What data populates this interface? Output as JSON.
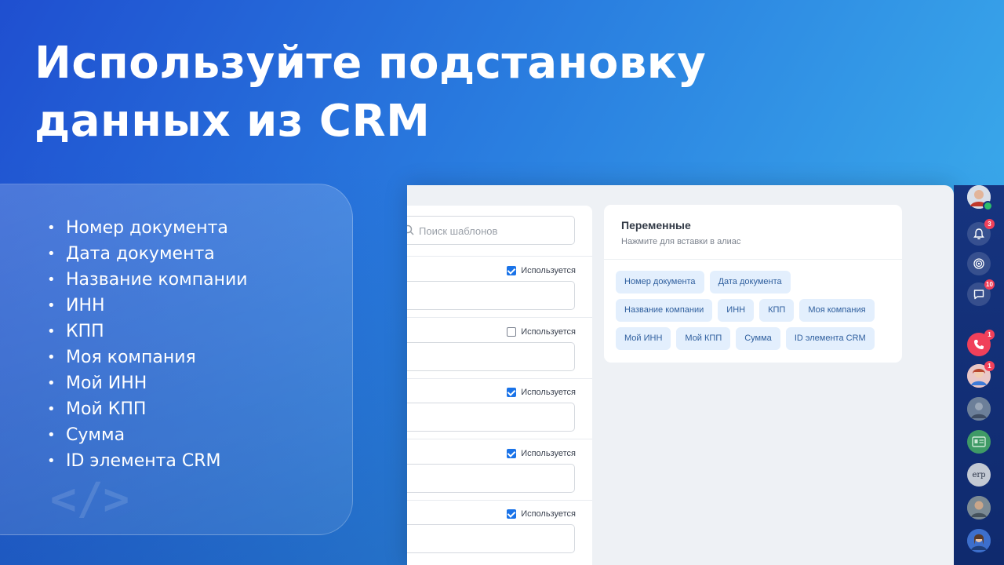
{
  "headline": {
    "line1": "Используйте подстановку",
    "line2": "данных из CRM"
  },
  "features": [
    "Номер документа",
    "Дата документа",
    "Название компании",
    "ИНН",
    "КПП",
    "Моя компания",
    "Мой ИНН",
    "Мой КПП",
    "Сумма",
    "ID элемента CRM"
  ],
  "templates": {
    "search_placeholder": "Поиск шаблонов",
    "rows": [
      {
        "used_label": "Используется",
        "checked": true
      },
      {
        "used_label": "Используется",
        "checked": false
      },
      {
        "used_label": "Используется",
        "checked": true
      },
      {
        "used_label": "Используется",
        "checked": true
      },
      {
        "used_label": "Используется",
        "checked": true
      }
    ]
  },
  "variables": {
    "title": "Переменные",
    "subtitle": "Нажмите для вставки в алиас",
    "chips": [
      [
        "Номер документа",
        "Дата документа"
      ],
      [
        "Название компании",
        "ИНН",
        "КПП",
        "Моя компания"
      ],
      [
        "Мой ИНН",
        "Мой КПП",
        "Сумма",
        "ID элемента CRM"
      ]
    ]
  },
  "sidebar": {
    "notifications_count": "3",
    "messages_count": "10",
    "calls_count": "1",
    "contact_count": "1",
    "erp_label": "erp",
    "accent": "#f0405a"
  }
}
